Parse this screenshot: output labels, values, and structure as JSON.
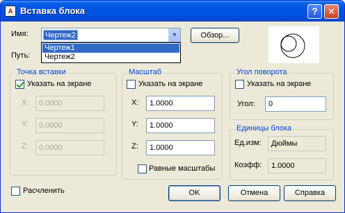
{
  "window": {
    "title": "Вставка блока",
    "help_button": "?",
    "close_button": "✕",
    "app_icon_label": "A"
  },
  "name_row": {
    "label": "Имя:",
    "value": "Чертеж2",
    "dropdown_items": [
      "Чертеж1",
      "Чертеж2"
    ],
    "browse_label": "Обзор..."
  },
  "path_row": {
    "label": "Путь:"
  },
  "insertion_point": {
    "title": "Точка вставки",
    "specify_on_screen_label": "Указать на экране",
    "specify_on_screen_checked": true,
    "x_label": "X:",
    "x_value": "0.0000",
    "y_label": "Y:",
    "y_value": "0.0000",
    "z_label": "Z:",
    "z_value": "0.0000"
  },
  "scale": {
    "title": "Масштаб",
    "specify_on_screen_label": "Указать на экране",
    "specify_on_screen_checked": false,
    "x_label": "X:",
    "x_value": "1.0000",
    "y_label": "Y:",
    "y_value": "1.0000",
    "z_label": "Z:",
    "z_value": "1.0000",
    "uniform_label": "Равные масштабы",
    "uniform_checked": false
  },
  "rotation": {
    "title": "Угол поворота",
    "specify_on_screen_label": "Указать на экране",
    "specify_on_screen_checked": false,
    "angle_label": "Угол:",
    "angle_value": "0"
  },
  "block_units": {
    "title": "Единицы блока",
    "unit_label": "Ед.изм:",
    "unit_value": "Дюймы",
    "factor_label": "Коэфф:",
    "factor_value": "1.0000"
  },
  "explode": {
    "label": "Расчленить",
    "checked": false
  },
  "buttons": {
    "ok": "OK",
    "cancel": "Отмена",
    "help": "Справка"
  },
  "colors": {
    "title_bar": "#0054e3",
    "group_title": "#0046d5",
    "selection": "#316ac5",
    "face": "#ece9d8"
  }
}
